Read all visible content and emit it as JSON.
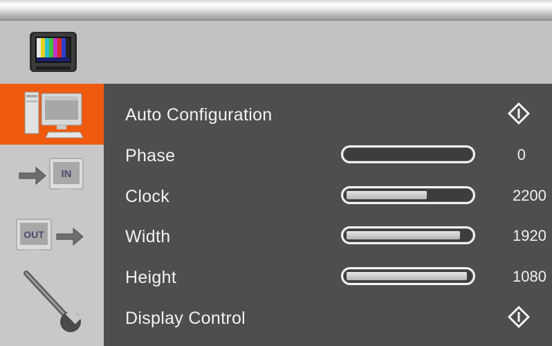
{
  "colors": {
    "accent": "#f05a0f",
    "panel": "#4e4e4e",
    "sidebar": "#c8c8c8",
    "header": "#c2c2c2",
    "text": "#f2f2f2"
  },
  "header": {
    "icon": "tv-color-bars-icon"
  },
  "sidebar": {
    "tabs": [
      {
        "id": "pc",
        "icon": "pc-monitor-icon",
        "active": true
      },
      {
        "id": "input",
        "icon": "input-arrow-icon",
        "icon_text": "IN",
        "active": false
      },
      {
        "id": "output",
        "icon": "output-arrow-icon",
        "icon_text": "OUT",
        "active": false
      },
      {
        "id": "tools",
        "icon": "wrench-icon",
        "active": false
      }
    ]
  },
  "menu": {
    "items": [
      {
        "label": "Auto Configuration",
        "type": "action",
        "icon": "enter-icon"
      },
      {
        "label": "Phase",
        "type": "slider",
        "value": "0",
        "level": 0.0
      },
      {
        "label": "Clock",
        "type": "slider",
        "value": "2200",
        "level": 0.65
      },
      {
        "label": "Width",
        "type": "slider",
        "value": "1920",
        "level": 0.92
      },
      {
        "label": "Height",
        "type": "slider",
        "value": "1080",
        "level": 0.98
      },
      {
        "label": "Display Control",
        "type": "action",
        "icon": "enter-icon"
      }
    ]
  }
}
